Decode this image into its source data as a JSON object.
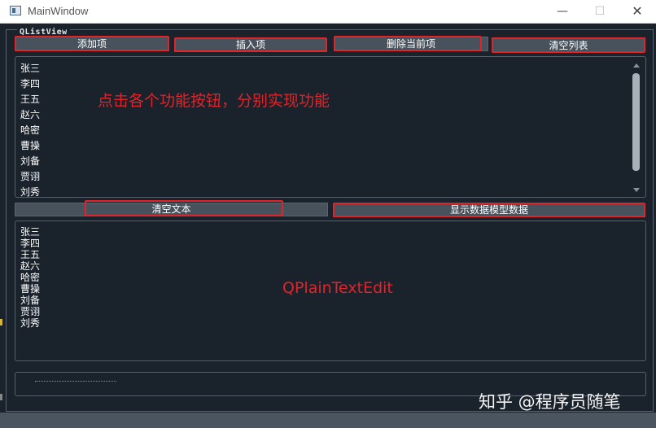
{
  "window": {
    "title": "MainWindow",
    "minimize": "—",
    "maximize": "☐",
    "close": "✕"
  },
  "group": {
    "title": "QListView"
  },
  "buttons": {
    "add": "添加项",
    "insert": "插入项",
    "delete_current": "删除当前项",
    "clear_list": "清空列表",
    "clear_text": "清空文本",
    "show_model_data": "显示数据模型数据"
  },
  "list_items": [
    "张三",
    "李四",
    "王五",
    "赵六",
    "哈密",
    "曹操",
    "刘备",
    "贾诩",
    "刘秀"
  ],
  "annotations": {
    "list_hint": "点击各个功能按钮，分别实现功能",
    "plain_text_label": "QPlainTextEdit"
  },
  "plain_text_lines": [
    "张三",
    "李四",
    "王五",
    "赵六",
    "哈密",
    "曹操",
    "刘备",
    "贾诩",
    "刘秀"
  ],
  "watermark": "知乎 @程序员随笔",
  "colors": {
    "highlight": "#e0242a",
    "background": "#1a222c",
    "button": "#47525d"
  }
}
